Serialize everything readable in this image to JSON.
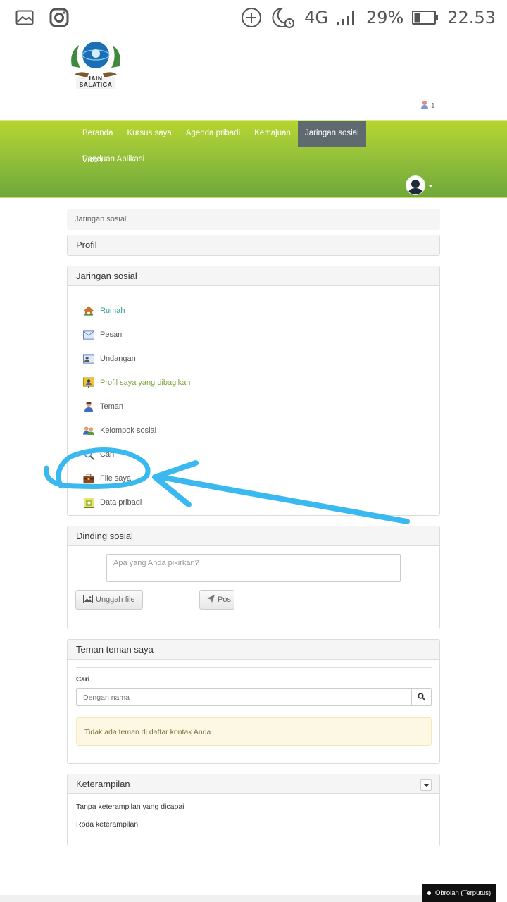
{
  "status_bar": {
    "network": "4G",
    "battery": "29%",
    "time": "22.53",
    "icons": [
      "gallery-icon",
      "instagram-icon",
      "add-circle-icon",
      "moon-alarm-icon",
      "signal-icon",
      "battery-icon"
    ]
  },
  "logo": {
    "text": "IAIN SALATIGA"
  },
  "header": {
    "notification_count": "1"
  },
  "nav": {
    "items": [
      "Beranda",
      "Kursus saya",
      "Agenda pribadi",
      "Kemajuan",
      "Jaringan sosial",
      "Panduan Aplikasi"
    ],
    "row2": [
      "Vicon"
    ],
    "active": "Jaringan sosial"
  },
  "breadcrumb": "Jaringan sosial",
  "profil_panel": {
    "title": "Profil"
  },
  "social_panel": {
    "title": "Jaringan sosial",
    "items": [
      {
        "label": "Rumah",
        "icon": "home-icon"
      },
      {
        "label": "Pesan",
        "icon": "envelope-icon"
      },
      {
        "label": "Undangan",
        "icon": "invitation-icon"
      },
      {
        "label": "Profil saya yang dibagikan",
        "icon": "shared-profile-icon"
      },
      {
        "label": "Teman",
        "icon": "friend-icon"
      },
      {
        "label": "Kelompok sosial",
        "icon": "group-icon"
      },
      {
        "label": "Cari",
        "icon": "search-icon"
      },
      {
        "label": "File saya",
        "icon": "briefcase-icon"
      },
      {
        "label": "Data pribadi",
        "icon": "personal-data-icon"
      }
    ]
  },
  "wall_panel": {
    "title": "Dinding sosial",
    "placeholder": "Apa yang Anda pikirkan?",
    "upload_label": "Unggah file",
    "post_label": "Pos"
  },
  "friends_panel": {
    "title": "Teman teman saya",
    "search_label": "Cari",
    "search_placeholder": "Dengan nama",
    "empty_message": "Tidak ada teman di daftar kontak Anda"
  },
  "skills_panel": {
    "title": "Keterampilan",
    "items": [
      "Tanpa keterampilan yang dicapai",
      "Roda keterampilan"
    ]
  },
  "chat": {
    "label": "Obrolan (Terputus)"
  },
  "colors": {
    "nav_top": "#b7d52f",
    "nav_bottom": "#6fa83a",
    "active_tab": "#5f6a70",
    "annotation": "#38bdf8"
  }
}
